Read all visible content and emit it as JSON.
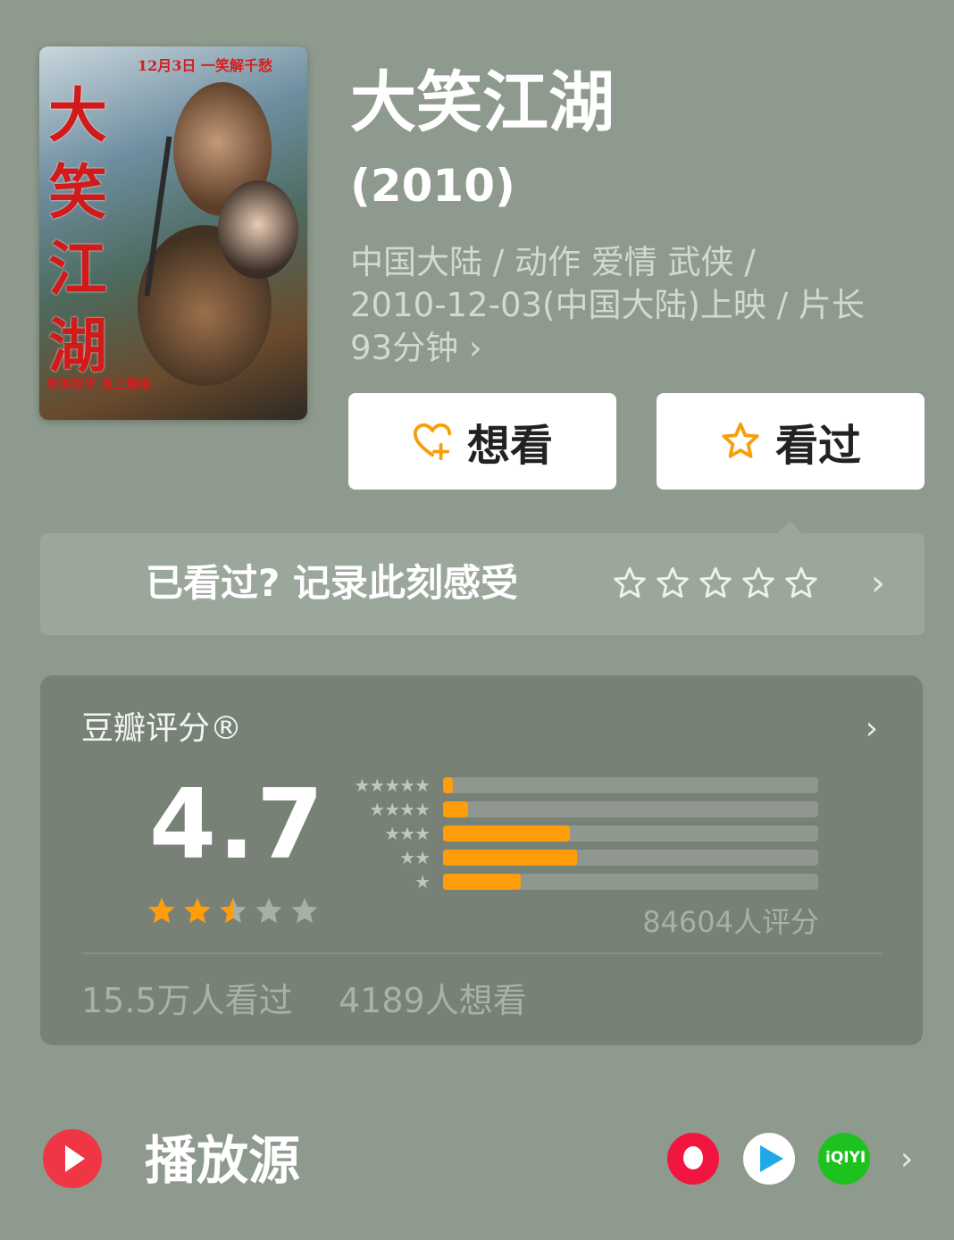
{
  "movie": {
    "title": "大笑江湖",
    "year": "(2010)",
    "meta_line1": "中国大陆 / 动作 爱情 武侠 /",
    "meta_line2": "2010-12-03(中国大陆)上映 / 片长",
    "meta_line3": "93分钟 ›"
  },
  "poster": {
    "tagline": "12月3日 一笑解千愁",
    "title_art": "大笑江湖",
    "footer": "笑侠贺岁 喜上眉梢"
  },
  "actions": {
    "want_label": "想看",
    "watched_label": "看过",
    "accent_color": "#f5a00b"
  },
  "record": {
    "prompt": "已看过? 记录此刻感受",
    "chevron": "›"
  },
  "rating": {
    "heading": "豆瓣评分®",
    "chevron": "›",
    "score": "4.7",
    "score_stars": 2.5,
    "distribution": [
      {
        "stars": "★★★★★",
        "percent": 2.6
      },
      {
        "stars": "★★★★",
        "percent": 6.7
      },
      {
        "stars": "★★★",
        "percent": 33.8
      },
      {
        "stars": "★★",
        "percent": 35.7
      },
      {
        "stars": "★",
        "percent": 20.7
      }
    ],
    "count": "84604人评分",
    "watched": "15.5万人看过",
    "wishes": "4189人想看",
    "bar_color": "#ff9d0b"
  },
  "sources": {
    "label": "播放源",
    "chevron": "›",
    "platforms": [
      "youku-logo",
      "tencent-video-logo",
      "iqiyi-logo"
    ],
    "iqiyi_text": "iQIYI"
  }
}
